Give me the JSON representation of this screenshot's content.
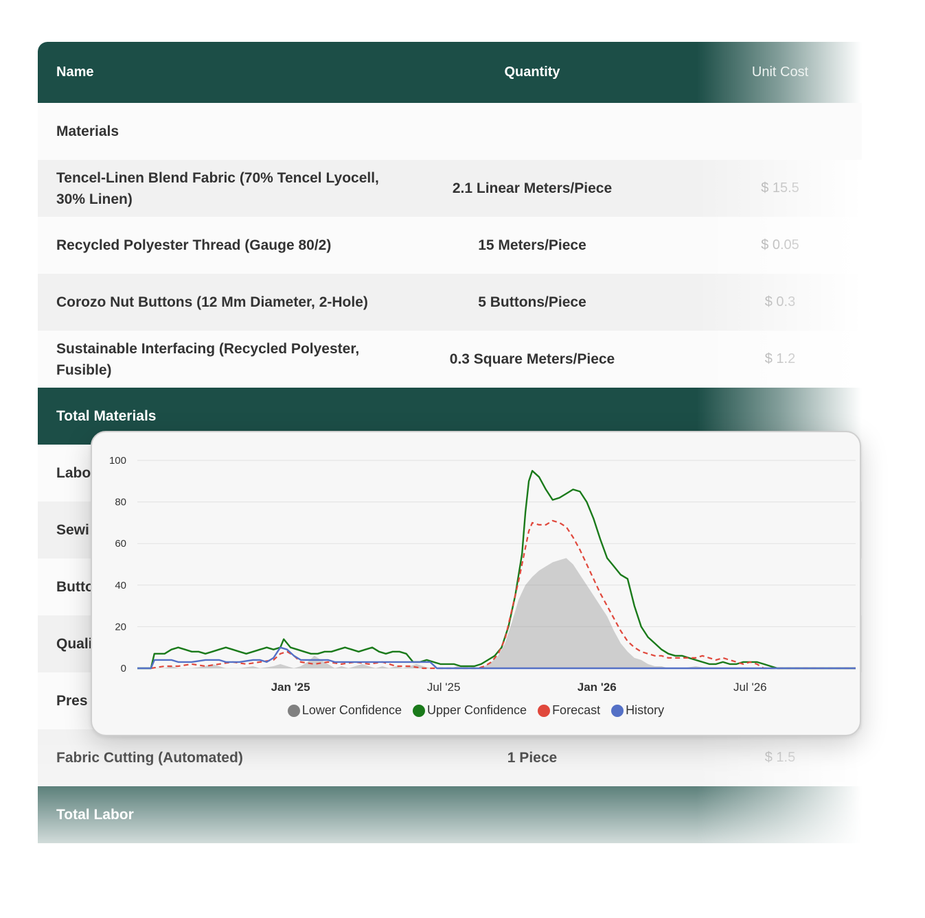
{
  "table": {
    "header": {
      "name": "Name",
      "quantity": "Quantity",
      "unit_cost": "Unit Cost"
    },
    "materials_label": "Materials",
    "materials": [
      {
        "name": "Tencel-Linen Blend Fabric (70% Tencel Lyocell, 30% Linen)",
        "quantity": "2.1 Linear Meters/Piece",
        "unit_cost": "$ 15.5"
      },
      {
        "name": "Recycled Polyester Thread (Gauge 80/2)",
        "quantity": "15 Meters/Piece",
        "unit_cost": "$ 0.05"
      },
      {
        "name": "Corozo Nut Buttons (12 Mm Diameter, 2-Hole)",
        "quantity": "5 Buttons/Piece",
        "unit_cost": "$ 0.3"
      },
      {
        "name": "Sustainable Interfacing (Recycled Polyester, Fusible)",
        "quantity": "0.3 Square Meters/Piece",
        "unit_cost": "$ 1.2"
      }
    ],
    "total_materials_label": "Total Materials",
    "labor_rows_partial": [
      "Labo",
      "Sewi",
      "Butto",
      "Quali",
      "Pres"
    ],
    "labor_last": {
      "name": "Fabric Cutting (Automated)",
      "quantity": "1 Piece",
      "unit_cost": "$ 1.5"
    },
    "total_labor_label": "Total Labor"
  },
  "colors": {
    "header_green": "#1c4e47",
    "lower_confidence": "#808080",
    "upper_confidence": "#1a7a1a",
    "forecast": "#e0483c",
    "history": "#5470c6"
  },
  "chart_data": {
    "type": "line",
    "y_ticks": [
      "100",
      "80",
      "60",
      "40",
      "20",
      "0"
    ],
    "ylim": [
      0,
      100
    ],
    "x_tick_labels": [
      {
        "label": "Jan '25",
        "bold": true
      },
      {
        "label": "Jul '25",
        "bold": false
      },
      {
        "label": "Jan '26",
        "bold": true
      },
      {
        "label": "Jul '26",
        "bold": false
      }
    ],
    "x_ticks_index": [
      45,
      90,
      135,
      180
    ],
    "x_count": 212,
    "grid": true,
    "legend_position": "bottom",
    "series": [
      {
        "name": "Lower Confidence",
        "style": "area",
        "points": [
          [
            0,
            0
          ],
          [
            8,
            0
          ],
          [
            10,
            1
          ],
          [
            12,
            0
          ],
          [
            16,
            0
          ],
          [
            20,
            1
          ],
          [
            22,
            2
          ],
          [
            24,
            1
          ],
          [
            26,
            0
          ],
          [
            30,
            0
          ],
          [
            34,
            1
          ],
          [
            36,
            0
          ],
          [
            40,
            1
          ],
          [
            42,
            2
          ],
          [
            44,
            1
          ],
          [
            46,
            0
          ],
          [
            48,
            1
          ],
          [
            50,
            3
          ],
          [
            52,
            6
          ],
          [
            54,
            4
          ],
          [
            56,
            2
          ],
          [
            58,
            0
          ],
          [
            60,
            1
          ],
          [
            62,
            0
          ],
          [
            64,
            1
          ],
          [
            66,
            2
          ],
          [
            68,
            1
          ],
          [
            70,
            0
          ],
          [
            72,
            1
          ],
          [
            74,
            0
          ],
          [
            76,
            1
          ],
          [
            78,
            0
          ],
          [
            80,
            1
          ],
          [
            82,
            2
          ],
          [
            84,
            1
          ],
          [
            86,
            0
          ],
          [
            92,
            0
          ],
          [
            94,
            1
          ],
          [
            96,
            0
          ],
          [
            100,
            0
          ],
          [
            102,
            1
          ],
          [
            104,
            3
          ],
          [
            106,
            6
          ],
          [
            108,
            12
          ],
          [
            110,
            22
          ],
          [
            112,
            33
          ],
          [
            114,
            40
          ],
          [
            116,
            44
          ],
          [
            118,
            47
          ],
          [
            120,
            49
          ],
          [
            122,
            51
          ],
          [
            124,
            52
          ],
          [
            126,
            53
          ],
          [
            128,
            50
          ],
          [
            130,
            45
          ],
          [
            132,
            40
          ],
          [
            134,
            35
          ],
          [
            136,
            30
          ],
          [
            138,
            25
          ],
          [
            140,
            18
          ],
          [
            142,
            12
          ],
          [
            144,
            8
          ],
          [
            146,
            5
          ],
          [
            148,
            4
          ],
          [
            150,
            2
          ],
          [
            152,
            1
          ],
          [
            154,
            1
          ],
          [
            156,
            0
          ],
          [
            160,
            0
          ],
          [
            164,
            1
          ],
          [
            168,
            0
          ],
          [
            211,
            0
          ]
        ]
      },
      {
        "name": "Upper Confidence",
        "style": "line",
        "points": [
          [
            0,
            0
          ],
          [
            4,
            0
          ],
          [
            5,
            7
          ],
          [
            8,
            7
          ],
          [
            10,
            9
          ],
          [
            12,
            10
          ],
          [
            14,
            9
          ],
          [
            16,
            8
          ],
          [
            18,
            8
          ],
          [
            20,
            7
          ],
          [
            22,
            8
          ],
          [
            24,
            9
          ],
          [
            26,
            10
          ],
          [
            28,
            9
          ],
          [
            30,
            8
          ],
          [
            32,
            7
          ],
          [
            34,
            8
          ],
          [
            36,
            9
          ],
          [
            38,
            10
          ],
          [
            40,
            9
          ],
          [
            42,
            10
          ],
          [
            43,
            14
          ],
          [
            45,
            10
          ],
          [
            47,
            9
          ],
          [
            49,
            8
          ],
          [
            51,
            7
          ],
          [
            53,
            7
          ],
          [
            55,
            8
          ],
          [
            57,
            8
          ],
          [
            59,
            9
          ],
          [
            61,
            10
          ],
          [
            63,
            9
          ],
          [
            65,
            8
          ],
          [
            67,
            9
          ],
          [
            69,
            10
          ],
          [
            71,
            8
          ],
          [
            73,
            7
          ],
          [
            75,
            8
          ],
          [
            77,
            8
          ],
          [
            79,
            7
          ],
          [
            81,
            3
          ],
          [
            83,
            3
          ],
          [
            85,
            4
          ],
          [
            87,
            3
          ],
          [
            89,
            2
          ],
          [
            91,
            2
          ],
          [
            93,
            2
          ],
          [
            95,
            1
          ],
          [
            97,
            1
          ],
          [
            99,
            1
          ],
          [
            101,
            2
          ],
          [
            103,
            4
          ],
          [
            105,
            6
          ],
          [
            107,
            10
          ],
          [
            109,
            20
          ],
          [
            111,
            35
          ],
          [
            113,
            55
          ],
          [
            114,
            75
          ],
          [
            115,
            90
          ],
          [
            116,
            95
          ],
          [
            118,
            92
          ],
          [
            120,
            86
          ],
          [
            122,
            81
          ],
          [
            124,
            82
          ],
          [
            126,
            84
          ],
          [
            128,
            86
          ],
          [
            130,
            85
          ],
          [
            132,
            80
          ],
          [
            134,
            72
          ],
          [
            136,
            62
          ],
          [
            138,
            53
          ],
          [
            140,
            49
          ],
          [
            142,
            45
          ],
          [
            144,
            43
          ],
          [
            146,
            30
          ],
          [
            148,
            20
          ],
          [
            150,
            15
          ],
          [
            152,
            12
          ],
          [
            154,
            9
          ],
          [
            156,
            7
          ],
          [
            158,
            6
          ],
          [
            160,
            6
          ],
          [
            162,
            5
          ],
          [
            164,
            4
          ],
          [
            166,
            3
          ],
          [
            168,
            2
          ],
          [
            170,
            2
          ],
          [
            172,
            3
          ],
          [
            174,
            2
          ],
          [
            176,
            2
          ],
          [
            178,
            3
          ],
          [
            180,
            3
          ],
          [
            182,
            3
          ],
          [
            184,
            2
          ],
          [
            186,
            1
          ],
          [
            188,
            0
          ],
          [
            211,
            0
          ]
        ]
      },
      {
        "name": "Forecast",
        "style": "dashed",
        "points": [
          [
            4,
            0
          ],
          [
            8,
            1
          ],
          [
            12,
            1
          ],
          [
            16,
            2
          ],
          [
            20,
            1
          ],
          [
            24,
            2
          ],
          [
            28,
            3
          ],
          [
            32,
            2
          ],
          [
            36,
            3
          ],
          [
            40,
            4
          ],
          [
            42,
            7
          ],
          [
            44,
            8
          ],
          [
            46,
            6
          ],
          [
            48,
            3
          ],
          [
            52,
            2
          ],
          [
            56,
            3
          ],
          [
            60,
            2
          ],
          [
            64,
            3
          ],
          [
            68,
            2
          ],
          [
            72,
            3
          ],
          [
            76,
            1
          ],
          [
            80,
            1
          ],
          [
            84,
            0
          ],
          [
            90,
            0
          ],
          [
            95,
            0
          ],
          [
            100,
            0
          ],
          [
            102,
            1
          ],
          [
            104,
            3
          ],
          [
            106,
            7
          ],
          [
            108,
            14
          ],
          [
            110,
            28
          ],
          [
            112,
            42
          ],
          [
            114,
            58
          ],
          [
            115,
            66
          ],
          [
            116,
            70
          ],
          [
            118,
            69
          ],
          [
            120,
            69
          ],
          [
            122,
            71
          ],
          [
            124,
            70
          ],
          [
            126,
            68
          ],
          [
            128,
            63
          ],
          [
            130,
            57
          ],
          [
            132,
            50
          ],
          [
            134,
            43
          ],
          [
            136,
            36
          ],
          [
            138,
            30
          ],
          [
            140,
            24
          ],
          [
            142,
            18
          ],
          [
            144,
            13
          ],
          [
            146,
            10
          ],
          [
            148,
            8
          ],
          [
            150,
            7
          ],
          [
            152,
            6
          ],
          [
            154,
            6
          ],
          [
            156,
            5
          ],
          [
            160,
            5
          ],
          [
            164,
            5
          ],
          [
            166,
            6
          ],
          [
            168,
            5
          ],
          [
            170,
            4
          ],
          [
            172,
            5
          ],
          [
            174,
            4
          ],
          [
            176,
            3
          ],
          [
            178,
            2
          ],
          [
            180,
            3
          ],
          [
            182,
            2
          ],
          [
            184,
            0
          ],
          [
            211,
            0
          ]
        ]
      },
      {
        "name": "History",
        "style": "line",
        "points": [
          [
            0,
            0
          ],
          [
            4,
            0
          ],
          [
            5,
            4
          ],
          [
            10,
            4
          ],
          [
            12,
            3
          ],
          [
            16,
            3
          ],
          [
            20,
            4
          ],
          [
            24,
            4
          ],
          [
            26,
            3
          ],
          [
            30,
            3
          ],
          [
            34,
            4
          ],
          [
            36,
            4
          ],
          [
            38,
            3
          ],
          [
            40,
            5
          ],
          [
            42,
            10
          ],
          [
            44,
            9
          ],
          [
            46,
            6
          ],
          [
            48,
            4
          ],
          [
            52,
            4
          ],
          [
            56,
            4
          ],
          [
            58,
            3
          ],
          [
            86,
            3
          ],
          [
            88,
            0
          ],
          [
            211,
            0
          ]
        ]
      }
    ]
  }
}
